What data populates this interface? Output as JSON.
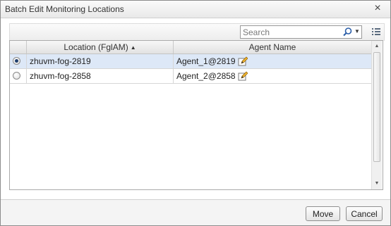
{
  "dialog": {
    "title": "Batch Edit Monitoring Locations",
    "close_glyph": "×"
  },
  "toolbar": {
    "search": {
      "placeholder": "Search",
      "value": "",
      "icon": "search-icon",
      "dropdown_glyph": "▼"
    },
    "columns_icon": "columns-menu-icon"
  },
  "grid": {
    "columns": [
      {
        "label": "Location (FglAM)",
        "sort": "ascending",
        "sort_glyph": "▲"
      },
      {
        "label": "Agent Name"
      }
    ],
    "rows": [
      {
        "selected": true,
        "location": "zhuvm-fog-2819",
        "agent": "Agent_1@2819"
      },
      {
        "selected": false,
        "location": "zhuvm-fog-2858",
        "agent": "Agent_2@2858"
      }
    ],
    "scroll": {
      "up_glyph": "▲",
      "down_glyph": "▼"
    }
  },
  "buttons": {
    "move": "Move",
    "cancel": "Cancel"
  },
  "colors": {
    "selected_row": "#dde8f7",
    "header_bg": "#e8e8e8"
  }
}
